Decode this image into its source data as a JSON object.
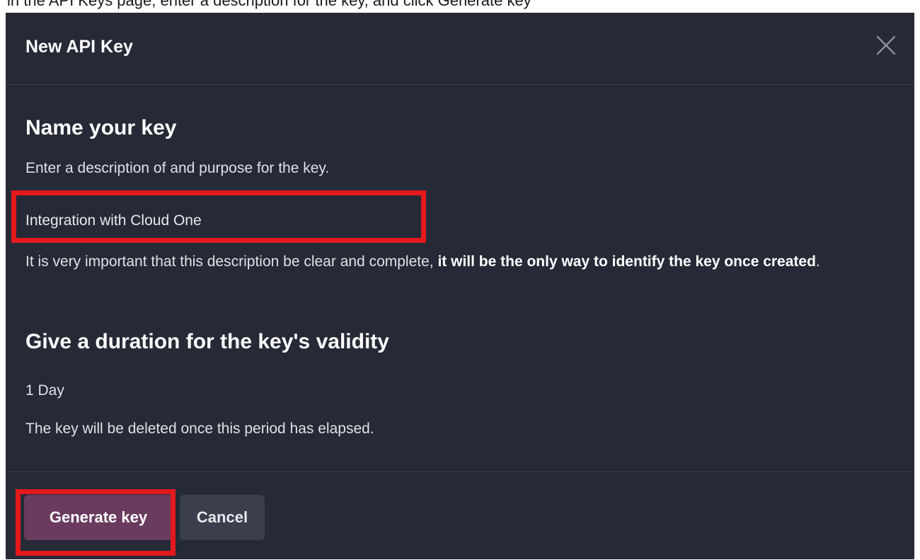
{
  "top_strip": {
    "text": "in the API Keys page, enter a description for the key, and click Generate key"
  },
  "modal": {
    "title": "New API Key",
    "close_icon": "close-icon"
  },
  "name_section": {
    "heading": "Name your key",
    "help": "Enter a description of and purpose for the key.",
    "input_value": "Integration with Cloud One",
    "important_prefix": "It is very important that this description be clear and complete, ",
    "important_bold": "it will be the only way to identify the key once created",
    "important_suffix": "."
  },
  "duration_section": {
    "heading": "Give a duration for the key's validity",
    "value": "1 Day",
    "note": "The key will be deleted once this period has elapsed."
  },
  "footer": {
    "generate_label": "Generate key",
    "cancel_label": "Cancel"
  },
  "colors": {
    "modal_bg": "#262a36",
    "primary_button": "#6a3b5f",
    "secondary_button": "#3b3f4d",
    "highlight": "#e3191c"
  }
}
